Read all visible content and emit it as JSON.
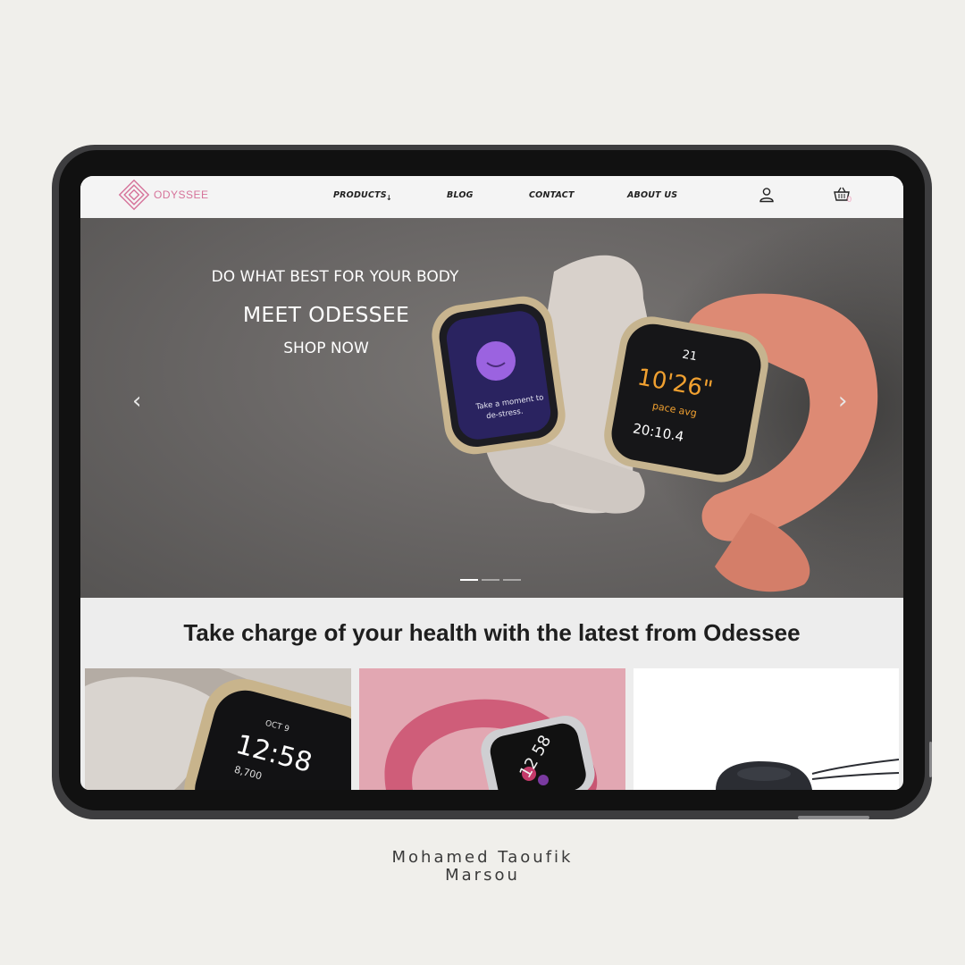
{
  "brand": {
    "name": "ODYSSEE",
    "color": "#d6739a"
  },
  "nav": {
    "links": [
      {
        "label": "PRODUCTS",
        "has_dropdown": true
      },
      {
        "label": "BLOG"
      },
      {
        "label": "CONTACT"
      },
      {
        "label": "ABOUT US"
      }
    ],
    "account_icon": "user-icon",
    "cart_icon": "basket-icon",
    "cart_count": "0"
  },
  "hero": {
    "tagline": "DO WHAT BEST FOR YOUR BODY",
    "title": "MEET ODESSEE",
    "cta": "SHOP NOW",
    "slide_count": 3,
    "active_slide": 1,
    "watch_left_screen": "Take a moment to de-stress.",
    "watch_right_screen": {
      "top": "21",
      "time": "10'26\"",
      "label": "pace avg",
      "duration": "20:10.4"
    }
  },
  "section": {
    "title": "Take charge of your health with the latest from Odessee",
    "cards": [
      {
        "name": "sense-watch",
        "screen": {
          "date": "OCT 9",
          "time": "12:58",
          "steps": "8,700"
        }
      },
      {
        "name": "luxe-tracker",
        "screen": {
          "time": "12 58"
        }
      },
      {
        "name": "charging-dock"
      }
    ]
  },
  "credit": {
    "line1": "Mohamed Taoufik",
    "line2": "Marsou"
  },
  "colors": {
    "background": "#f0efeb",
    "hero_bg": "#6a6766",
    "accent_pink": "#e3a7b3",
    "strap_coral": "#dd8a74"
  }
}
